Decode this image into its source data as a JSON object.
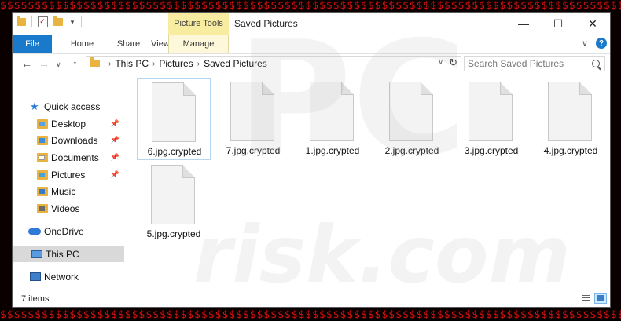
{
  "background": {
    "lines": [
      "$$$$$$$$$$$$$$$$$$$$$$$$$$$$$$$$$$$$$$$$$$$$$$$$$$$$$$$$$$$$$$$$$$$$$$$$$$$$$$$$$$$$$$$$$$"
    ]
  },
  "window": {
    "title": "Saved Pictures",
    "contextual_tab_group": "Picture Tools",
    "controls": {
      "minimize": "—",
      "maximize": "☐",
      "close": "✕"
    }
  },
  "quick_access_toolbar": {
    "dropdown": "▾"
  },
  "ribbon": {
    "tabs": {
      "file": "File",
      "home": "Home",
      "share": "Share",
      "view": "View",
      "manage": "Manage"
    },
    "collapse": "∨",
    "help": "?"
  },
  "address_bar": {
    "back": "←",
    "forward": "→",
    "recent": "∨",
    "up": "↑",
    "crumbs": [
      "This PC",
      "Pictures",
      "Saved Pictures"
    ],
    "separator": "›",
    "dropdown": "∨",
    "refresh": "↻"
  },
  "search": {
    "placeholder": "Search Saved Pictures"
  },
  "navigation": {
    "quick_access": "Quick access",
    "desktop": "Desktop",
    "downloads": "Downloads",
    "documents": "Documents",
    "pictures": "Pictures",
    "music": "Music",
    "videos": "Videos",
    "onedrive": "OneDrive",
    "this_pc": "This PC",
    "network": "Network",
    "pin": "📌"
  },
  "files": [
    {
      "name": "6.jpg.crypted"
    },
    {
      "name": "7.jpg.crypted"
    },
    {
      "name": "1.jpg.crypted"
    },
    {
      "name": "2.jpg.crypted"
    },
    {
      "name": "3.jpg.crypted"
    },
    {
      "name": "4.jpg.crypted"
    },
    {
      "name": "5.jpg.crypted"
    }
  ],
  "status": {
    "count": "7 items"
  },
  "watermark": {
    "text": "PC",
    "subtext": "risk.com"
  },
  "colors": {
    "accent": "#1979ca",
    "picture_tools": "#f8eca0",
    "selection": "#cde8ff",
    "background_text": "#d01010"
  }
}
